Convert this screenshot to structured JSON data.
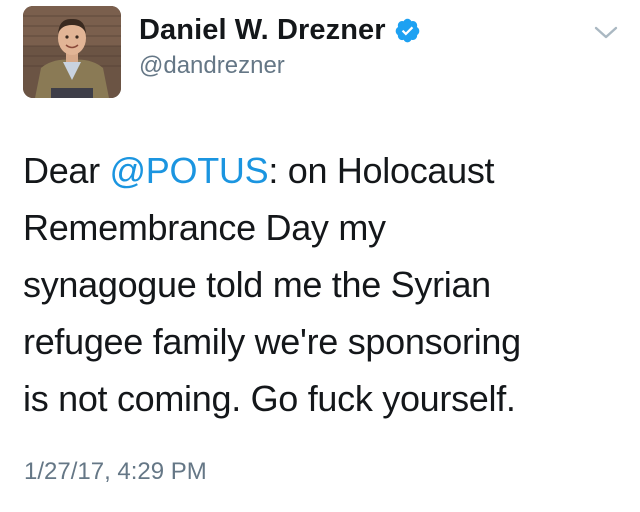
{
  "author": {
    "display_name": "Daniel W. Drezner",
    "handle": "@dandrezner",
    "verified": true,
    "avatar_icon": "profile-photo",
    "verified_icon": "verified-badge-icon"
  },
  "menu": {
    "icon": "chevron-down-icon"
  },
  "tweet": {
    "line1_prefix": "Dear ",
    "mention": "@POTUS",
    "line1_suffix": ": on Holocaust",
    "line2": "Remembrance Day my",
    "line3": "synagogue told me the Syrian",
    "line4": "refugee family we're sponsoring",
    "line5": "is not coming. Go fuck yourself."
  },
  "timestamp": "1/27/17, 4:29 PM",
  "colors": {
    "mention": "#1b95e0",
    "verified": "#1da1f2",
    "text": "#14171a",
    "muted": "#657786"
  }
}
